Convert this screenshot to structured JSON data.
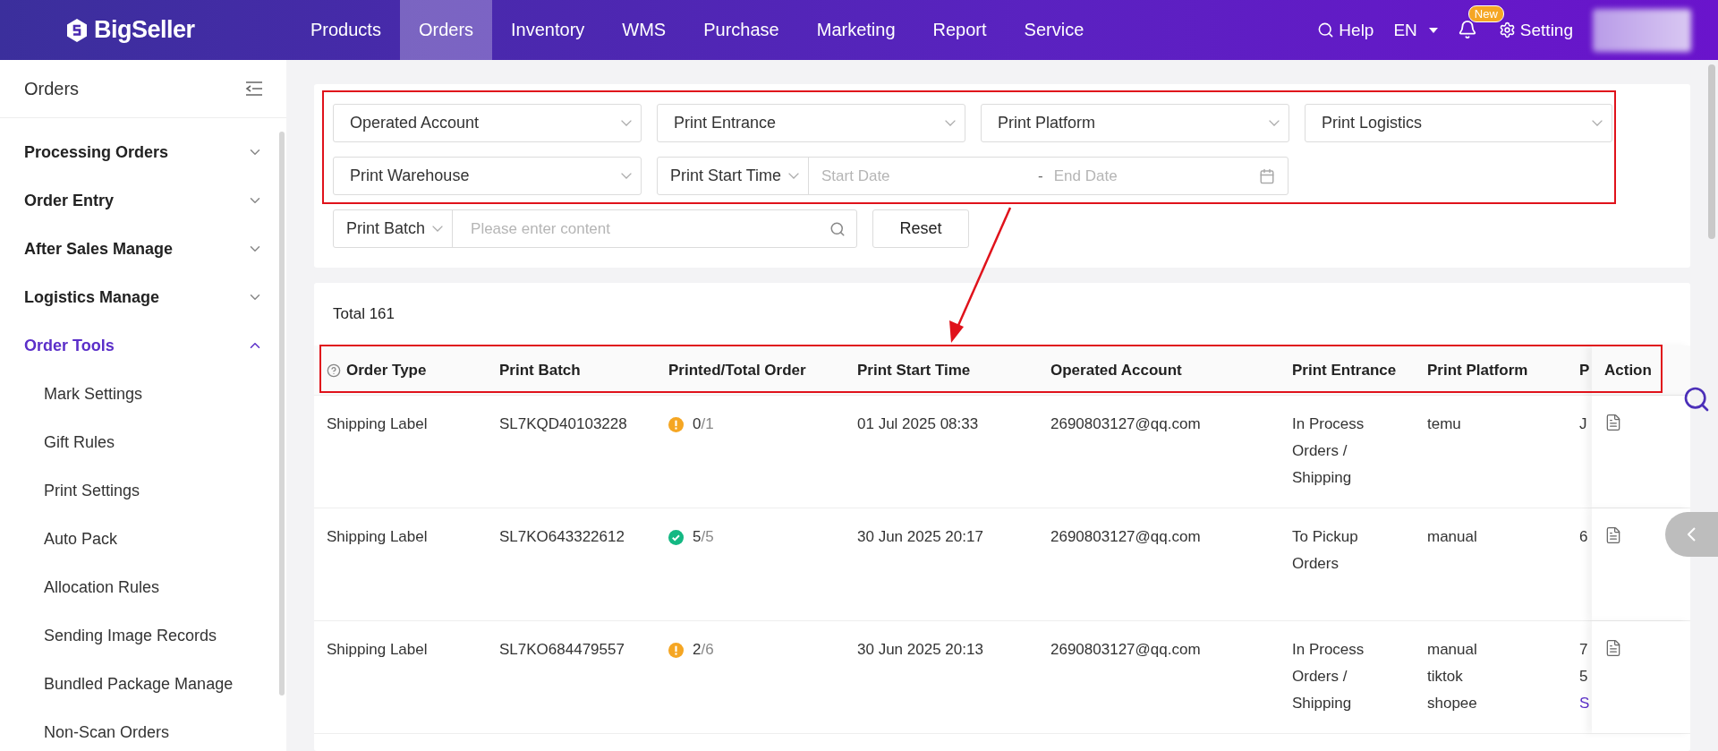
{
  "top_nav": {
    "logo": "BigSeller",
    "items": [
      {
        "label": "Products",
        "selected": false
      },
      {
        "label": "Orders",
        "selected": true
      },
      {
        "label": "Inventory",
        "selected": false
      },
      {
        "label": "WMS",
        "selected": false
      },
      {
        "label": "Purchase",
        "selected": false
      },
      {
        "label": "Marketing",
        "selected": false
      },
      {
        "label": "Report",
        "selected": false
      },
      {
        "label": "Service",
        "selected": false
      }
    ],
    "help": "Help",
    "language": "EN",
    "badge": "New",
    "setting": "Setting"
  },
  "sidebar": {
    "title": "Orders",
    "groups": [
      {
        "label": "Processing Orders",
        "expanded": false,
        "selected": false
      },
      {
        "label": "Order Entry",
        "expanded": false,
        "selected": false
      },
      {
        "label": "After Sales Manage",
        "expanded": false,
        "selected": false
      },
      {
        "label": "Logistics Manage",
        "expanded": false,
        "selected": false
      },
      {
        "label": "Order Tools",
        "expanded": true,
        "selected": true,
        "children": [
          "Mark Settings",
          "Gift Rules",
          "Print Settings",
          "Auto Pack",
          "Allocation Rules",
          "Sending Image Records",
          "Bundled Package Manage",
          "Non-Scan Orders"
        ]
      }
    ]
  },
  "filters": {
    "selects": [
      "Operated Account",
      "Print Entrance",
      "Print Platform",
      "Print Logistics",
      "Print Warehouse"
    ],
    "time_select": "Print Start Time",
    "start_placeholder": "Start Date",
    "separator": "-",
    "end_placeholder": "End Date",
    "batch_select": "Print Batch",
    "search_placeholder": "Please enter content",
    "reset": "Reset"
  },
  "table": {
    "total": "Total 161",
    "columns": [
      "Order Type",
      "Print Batch",
      "Printed/Total Order",
      "Print Start Time",
      "Operated Account",
      "Print Entrance",
      "Print Platform",
      "P",
      "Action"
    ],
    "rows": [
      {
        "order_type": "Shipping Label",
        "batch": "SL7KQD40103228",
        "printed": "0",
        "total": "/1",
        "kind": "warning",
        "time": "01 Jul 2025 08:33",
        "account": "2690803127@qq.com",
        "entrance": "In Process Orders / Shipping",
        "platforms": [
          "temu"
        ],
        "column_8": [
          {
            "text": "J",
            "link": false
          }
        ]
      },
      {
        "order_type": "Shipping Label",
        "batch": "SL7KO643322612",
        "printed": "5",
        "total": "/5",
        "kind": "done",
        "time": "30 Jun 2025 20:17",
        "account": "2690803127@qq.com",
        "entrance": "To Pickup Orders",
        "platforms": [
          "manual"
        ],
        "column_8": [
          {
            "text": "6",
            "link": false
          }
        ]
      },
      {
        "order_type": "Shipping Label",
        "batch": "SL7KO684479557",
        "printed": "2",
        "total": "/6",
        "kind": "warning",
        "time": "30 Jun 2025 20:13",
        "account": "2690803127@qq.com",
        "entrance": "In Process Orders / Shipping",
        "platforms": [
          "manual",
          "tiktok",
          "shopee"
        ],
        "column_8": [
          {
            "text": "7",
            "link": false
          },
          {
            "text": "5",
            "link": false
          },
          {
            "text": "S",
            "link": true
          }
        ]
      }
    ]
  }
}
